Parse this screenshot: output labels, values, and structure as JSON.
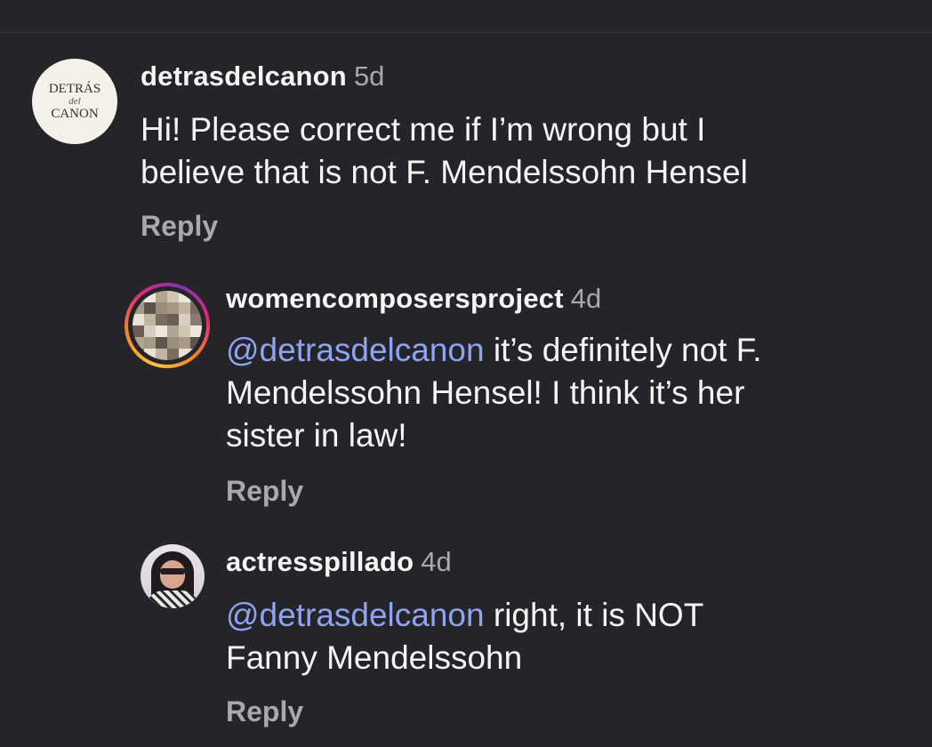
{
  "comments": [
    {
      "username": "detrasdelcanon",
      "time": "5d",
      "avatar_text": [
        "DETRÁS",
        "del",
        "CANON"
      ],
      "lines": [
        "Hi! Please correct me if I’m wrong but I",
        "believe that is not F. Mendelssohn Hensel"
      ],
      "reply_label": "Reply"
    },
    {
      "username": "womencomposersproject",
      "time": "4d",
      "mention": "@detrasdelcanon",
      "lines": [
        " it’s definitely not F.",
        "Mendelssohn Hensel! I think it’s her",
        "sister in law!"
      ],
      "reply_label": "Reply"
    },
    {
      "username": "actresspillado",
      "time": "4d",
      "mention": "@detrasdelcanon",
      "lines": [
        " right, it is NOT",
        "Fanny Mendelssohn"
      ],
      "reply_label": "Reply"
    }
  ],
  "colors": {
    "background": "#252429",
    "mention": "#8ea3f2",
    "secondary_text": "#a8a8ad",
    "primary_text": "#f5f5f5"
  }
}
